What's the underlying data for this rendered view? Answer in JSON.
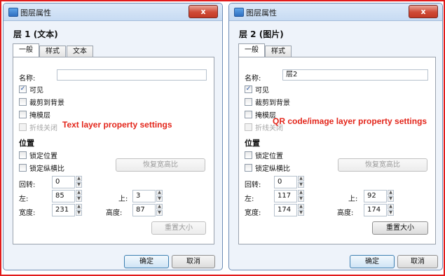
{
  "left_dialog": {
    "title": "图层属性",
    "close_label": "x",
    "heading": "层 1 (文本)",
    "tabs": [
      "一般",
      "样式",
      "文本"
    ],
    "name_label": "名称:",
    "name_value": "",
    "checkboxes": [
      {
        "label": "可见",
        "checked": true,
        "disabled": false
      },
      {
        "label": "裁剪到背景",
        "checked": false,
        "disabled": false
      },
      {
        "label": "掩模层",
        "checked": false,
        "disabled": false
      },
      {
        "label": "折线关闭",
        "checked": false,
        "disabled": true
      }
    ],
    "annotation": "Text layer property settings",
    "position_section": "位置",
    "lock_position": "锁定位置",
    "lock_aspect": "锁定纵横比",
    "restore_aspect_button": "恢复宽高比",
    "rotate_label": "回转:",
    "rotate_value": "0",
    "left_label": "左:",
    "left_value": "85",
    "top_label": "上:",
    "top_value": "3",
    "width_label": "宽度:",
    "width_value": "231",
    "height_label": "高度:",
    "height_value": "87",
    "reset_size_button": "重置大小",
    "ok_button": "确定",
    "cancel_button": "取消"
  },
  "right_dialog": {
    "title": "图层属性",
    "close_label": "x",
    "heading": "层 2 (图片)",
    "tabs": [
      "一般",
      "样式"
    ],
    "name_label": "名称:",
    "name_value": "层2",
    "checkboxes": [
      {
        "label": "可见",
        "checked": true,
        "disabled": false
      },
      {
        "label": "裁剪到背景",
        "checked": false,
        "disabled": false
      },
      {
        "label": "掩模层",
        "checked": false,
        "disabled": false
      },
      {
        "label": "折线关闭",
        "checked": false,
        "disabled": true
      }
    ],
    "annotation": "QR code/image layer property settings",
    "position_section": "位置",
    "lock_position": "锁定位置",
    "lock_aspect": "锁定纵横比",
    "restore_aspect_button": "恢复宽高比",
    "rotate_label": "回转:",
    "rotate_value": "0",
    "left_label": "左:",
    "left_value": "117",
    "top_label": "上:",
    "top_value": "92",
    "width_label": "宽度:",
    "width_value": "174",
    "height_label": "高度:",
    "height_value": "174",
    "reset_size_button": "重置大小",
    "ok_button": "确定",
    "cancel_button": "取消"
  },
  "colors": {
    "frame_border": "#e11b1b",
    "annotation": "#e3261b",
    "dialog_bg": "#eef3fa",
    "close_button": "#cf4a36"
  }
}
